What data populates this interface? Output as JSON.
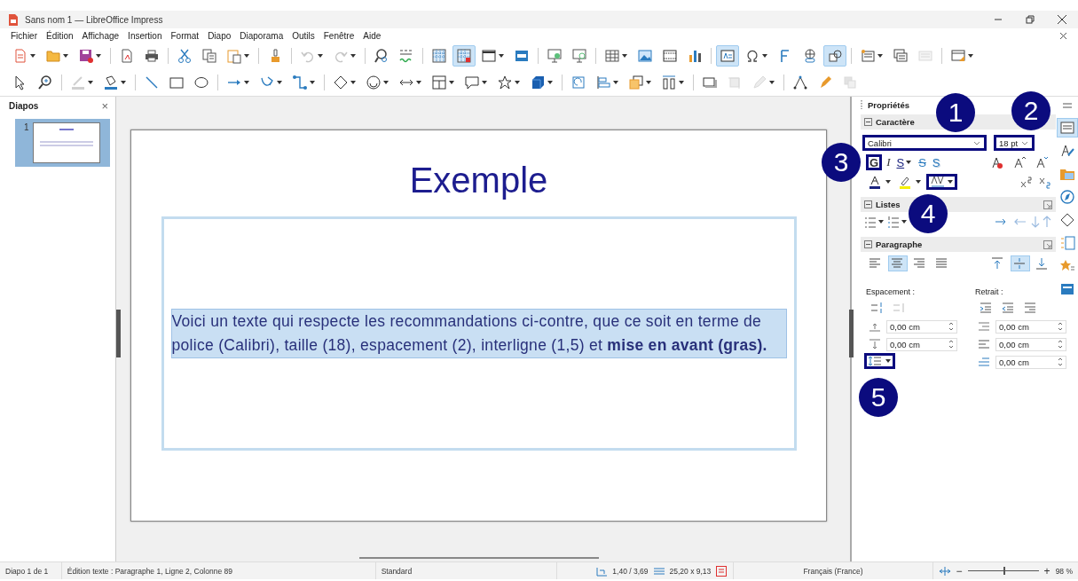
{
  "window": {
    "title": "Sans nom 1 — LibreOffice Impress"
  },
  "menu": [
    "Fichier",
    "Édition",
    "Affichage",
    "Insertion",
    "Format",
    "Diapo",
    "Diaporama",
    "Outils",
    "Fenêtre",
    "Aide"
  ],
  "toolbars": [
    {
      "items": [
        {
          "kind": "tool",
          "menu": true,
          "pressed": false,
          "disabled": false
        },
        {
          "kind": "tool",
          "menu": true,
          "pressed": false,
          "disabled": false
        },
        {
          "kind": "tool",
          "menu": true,
          "pressed": false,
          "disabled": false
        },
        {
          "kind": "separator"
        },
        {
          "kind": "tool",
          "menu": false,
          "pressed": false,
          "disabled": false
        },
        {
          "kind": "tool",
          "menu": false,
          "pressed": false,
          "disabled": false
        },
        {
          "kind": "separator"
        },
        {
          "kind": "tool",
          "menu": false,
          "pressed": false,
          "disabled": false
        },
        {
          "kind": "tool",
          "menu": false,
          "pressed": false,
          "disabled": false
        },
        {
          "kind": "tool",
          "menu": true,
          "pressed": false,
          "disabled": false
        },
        {
          "kind": "separator"
        },
        {
          "kind": "tool",
          "menu": false,
          "pressed": false,
          "disabled": false
        },
        {
          "kind": "separator"
        },
        {
          "kind": "tool",
          "menu": true,
          "pressed": false,
          "disabled": true
        },
        {
          "kind": "tool",
          "menu": true,
          "pressed": false,
          "disabled": true
        },
        {
          "kind": "separator"
        },
        {
          "kind": "tool",
          "menu": false,
          "pressed": false,
          "disabled": false
        },
        {
          "kind": "tool",
          "menu": false,
          "pressed": false,
          "disabled": false
        },
        {
          "kind": "separator"
        },
        {
          "kind": "tool",
          "menu": false,
          "pressed": false,
          "disabled": false
        },
        {
          "kind": "tool",
          "menu": false,
          "pressed": true,
          "disabled": false
        },
        {
          "kind": "tool",
          "menu": true,
          "pressed": false,
          "disabled": false
        },
        {
          "kind": "tool",
          "menu": false,
          "pressed": false,
          "disabled": false
        },
        {
          "kind": "separator"
        },
        {
          "kind": "tool",
          "menu": false,
          "pressed": false,
          "disabled": false
        },
        {
          "kind": "tool",
          "menu": false,
          "pressed": false,
          "disabled": false
        },
        {
          "kind": "separator"
        },
        {
          "kind": "tool",
          "menu": true,
          "pressed": false,
          "disabled": false
        },
        {
          "kind": "tool",
          "menu": false,
          "pressed": false,
          "disabled": false
        },
        {
          "kind": "tool",
          "menu": false,
          "pressed": false,
          "disabled": false
        },
        {
          "kind": "tool",
          "menu": false,
          "pressed": false,
          "disabled": false
        },
        {
          "kind": "separator"
        },
        {
          "kind": "tool",
          "menu": false,
          "pressed": true,
          "disabled": false
        },
        {
          "kind": "tool",
          "menu": true,
          "pressed": false,
          "disabled": false
        },
        {
          "kind": "tool",
          "menu": false,
          "pressed": false,
          "disabled": false
        },
        {
          "kind": "tool",
          "menu": false,
          "pressed": false,
          "disabled": false
        },
        {
          "kind": "tool",
          "menu": false,
          "pressed": true,
          "disabled": false
        },
        {
          "kind": "separator"
        },
        {
          "kind": "tool",
          "menu": true,
          "pressed": false,
          "disabled": false
        },
        {
          "kind": "tool",
          "menu": false,
          "pressed": false,
          "disabled": false
        },
        {
          "kind": "tool",
          "menu": false,
          "pressed": false,
          "disabled": true
        },
        {
          "kind": "separator"
        },
        {
          "kind": "tool",
          "menu": true,
          "pressed": false,
          "disabled": false
        }
      ]
    },
    {
      "items": [
        {
          "kind": "tool",
          "menu": false,
          "pressed": false,
          "disabled": false
        },
        {
          "kind": "tool",
          "menu": false,
          "pressed": false,
          "disabled": false
        },
        {
          "kind": "separator"
        },
        {
          "kind": "tool",
          "menu": true,
          "pressed": false,
          "disabled": true
        },
        {
          "kind": "tool",
          "menu": true,
          "pressed": false,
          "disabled": false
        },
        {
          "kind": "separator"
        },
        {
          "kind": "tool",
          "menu": false,
          "pressed": false,
          "disabled": false
        },
        {
          "kind": "tool",
          "menu": false,
          "pressed": false,
          "disabled": false
        },
        {
          "kind": "tool",
          "menu": false,
          "pressed": false,
          "disabled": false
        },
        {
          "kind": "separator"
        },
        {
          "kind": "tool",
          "menu": true,
          "pressed": false,
          "disabled": false
        },
        {
          "kind": "tool",
          "menu": true,
          "pressed": false,
          "disabled": false
        },
        {
          "kind": "tool",
          "menu": true,
          "pressed": false,
          "disabled": false
        },
        {
          "kind": "separator"
        },
        {
          "kind": "tool",
          "menu": true,
          "pressed": false,
          "disabled": false
        },
        {
          "kind": "tool",
          "menu": true,
          "pressed": false,
          "disabled": false
        },
        {
          "kind": "tool",
          "menu": true,
          "pressed": false,
          "disabled": false
        },
        {
          "kind": "tool",
          "menu": true,
          "pressed": false,
          "disabled": false
        },
        {
          "kind": "tool",
          "menu": true,
          "pressed": false,
          "disabled": false
        },
        {
          "kind": "tool",
          "menu": true,
          "pressed": false,
          "disabled": false
        },
        {
          "kind": "tool",
          "menu": true,
          "pressed": false,
          "disabled": false
        },
        {
          "kind": "separator"
        },
        {
          "kind": "tool",
          "menu": false,
          "pressed": false,
          "disabled": false
        },
        {
          "kind": "tool",
          "menu": true,
          "pressed": false,
          "disabled": false
        },
        {
          "kind": "tool",
          "menu": true,
          "pressed": false,
          "disabled": false
        },
        {
          "kind": "tool",
          "menu": true,
          "pressed": false,
          "disabled": false
        },
        {
          "kind": "separator"
        },
        {
          "kind": "tool",
          "menu": false,
          "pressed": false,
          "disabled": false
        },
        {
          "kind": "tool",
          "menu": false,
          "pressed": false,
          "disabled": true
        },
        {
          "kind": "tool",
          "menu": true,
          "pressed": false,
          "disabled": true
        },
        {
          "kind": "separator"
        },
        {
          "kind": "tool",
          "menu": false,
          "pressed": false,
          "disabled": false
        },
        {
          "kind": "tool",
          "menu": false,
          "pressed": false,
          "disabled": false
        },
        {
          "kind": "tool",
          "menu": false,
          "pressed": false,
          "disabled": true
        }
      ]
    }
  ],
  "slides_pane": {
    "title": "Diapos",
    "close": "×",
    "slides": [
      {
        "number": "1",
        "selected": true
      }
    ]
  },
  "slide": {
    "title": "Exemple",
    "body": "Voici un texte qui respecte les recommandations ci-contre, que ce soit en terme de police (Calibri), taille (18), espacement (2), interligne (1,5) et **mise en avant (gras).**",
    "body_selected": true
  },
  "sidebar": {
    "title": "Propriétés",
    "character": {
      "title": "Caractère",
      "expanded": true,
      "font": {
        "value": "Calibri",
        "highlighted": true
      },
      "size": {
        "value": "18 pt",
        "highlighted": true
      },
      "styles": [
        {
          "kind": "bold",
          "label": "G",
          "menu": false,
          "highlighted": true
        },
        {
          "kind": "italic",
          "label": "I",
          "menu": false,
          "highlighted": false
        },
        {
          "kind": "underline",
          "label": "S",
          "menu": true,
          "highlighted": false
        },
        {
          "kind": "strike",
          "label": "S",
          "menu": false,
          "highlighted": false
        },
        {
          "kind": "shadow",
          "label": "S",
          "menu": false,
          "highlighted": false
        }
      ],
      "spacing_highlighted": true
    },
    "lists": {
      "title": "Listes",
      "expanded": true
    },
    "paragraph": {
      "title": "Paragraphe",
      "expanded": true,
      "align": [
        {
          "selected": false
        },
        {
          "selected": true
        },
        {
          "selected": false
        },
        {
          "selected": false
        }
      ],
      "valign": [
        {
          "selected": false
        },
        {
          "selected": true
        },
        {
          "selected": false
        }
      ],
      "spacing_label": "Espacement :",
      "indent_label": "Retrait :",
      "spacing": [
        "0,00 cm",
        "0,00 cm"
      ],
      "indent": [
        "0,00 cm",
        "0,00 cm",
        "0,00 cm"
      ],
      "line_spacing_highlighted": true
    },
    "deck": [
      {
        "selected": true
      },
      {
        "selected": false
      },
      {
        "selected": false
      },
      {
        "selected": false
      },
      {
        "selected": false
      },
      {
        "selected": false
      },
      {
        "selected": false
      },
      {
        "selected": false
      }
    ]
  },
  "annotations": [
    {
      "label": "1"
    },
    {
      "label": "2"
    },
    {
      "label": "3"
    },
    {
      "label": "4"
    },
    {
      "label": "5"
    }
  ],
  "status_bar": {
    "slide": "Diapo 1 de 1",
    "mode": "Édition texte : Paragraphe 1, Ligne 2, Colonne 89",
    "layout": "Standard",
    "position": "1,40 / 3,69",
    "size": "25,20 x 9,13",
    "language": "Français (France)",
    "zoom_out": "−",
    "zoom_in": "+",
    "zoom": {
      "level": 0.5
    },
    "zoom_text": "98 %"
  }
}
